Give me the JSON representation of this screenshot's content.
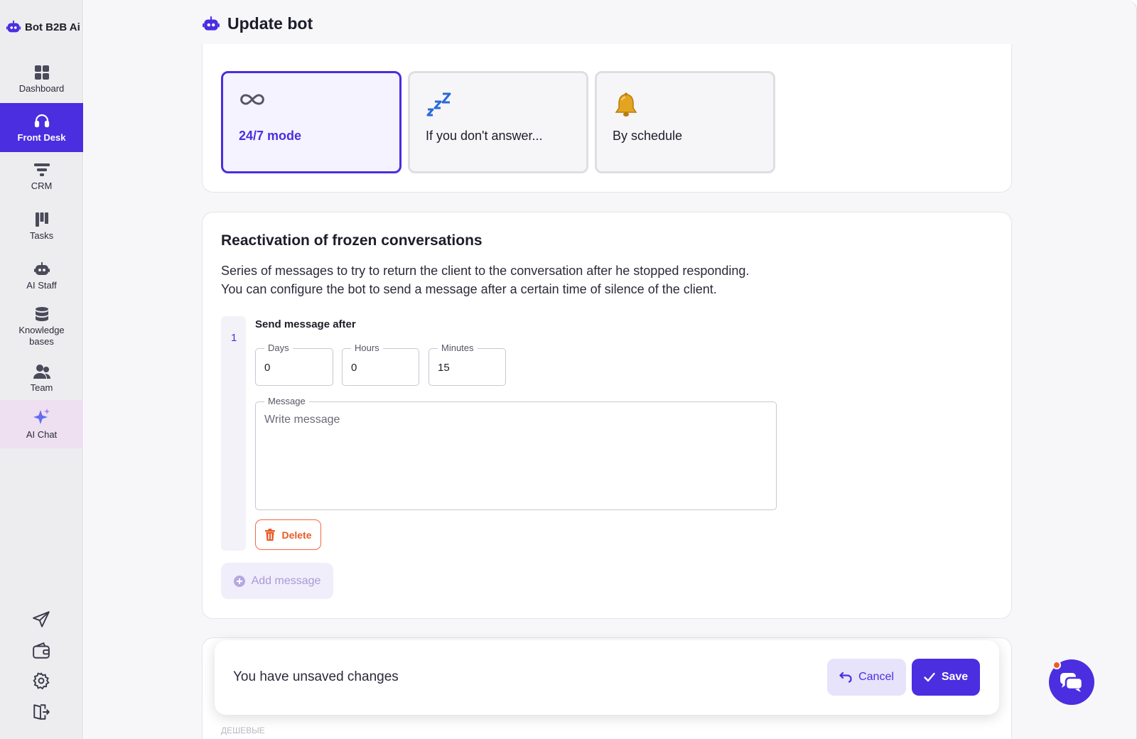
{
  "brand": {
    "name": "Bot B2B Ai"
  },
  "sidebar": {
    "items": [
      {
        "label": "Dashboard",
        "icon": "dashboard-grid-icon"
      },
      {
        "label": "Front Desk",
        "icon": "headset-icon",
        "active": true
      },
      {
        "label": "CRM",
        "icon": "funnel-icon"
      },
      {
        "label": "Tasks",
        "icon": "kanban-icon"
      },
      {
        "label": "AI Staff",
        "icon": "robot-icon"
      },
      {
        "label": "Knowledge bases",
        "icon": "database-icon"
      },
      {
        "label": "Team",
        "icon": "team-icon"
      },
      {
        "label": "AI Chat",
        "icon": "sparkle-icon"
      }
    ],
    "bottom_icons": [
      "send-icon",
      "wallet-icon",
      "settings-icon",
      "logout-icon"
    ]
  },
  "header": {
    "title": "Update bot",
    "icon": "robot-icon"
  },
  "modes": [
    {
      "label": "24/7 mode",
      "icon": "infinity-icon",
      "selected": true
    },
    {
      "label": "If you don't answer...",
      "icon": "zzz-icon",
      "selected": false
    },
    {
      "label": "By schedule",
      "icon": "bell-icon",
      "selected": false
    }
  ],
  "reactivation": {
    "title": "Reactivation of frozen conversations",
    "description_line1": "Series of messages to try to return the client to the conversation after he stopped responding.",
    "description_line2": "You can configure the bot to send a message after a certain time of silence of the client.",
    "step_number": "1",
    "send_after_label": "Send message after",
    "days": {
      "label": "Days",
      "value": "0"
    },
    "hours": {
      "label": "Hours",
      "value": "0"
    },
    "minutes": {
      "label": "Minutes",
      "value": "15"
    },
    "message": {
      "label": "Message",
      "placeholder": "Write message"
    },
    "delete_label": "Delete",
    "add_message_label": "Add message"
  },
  "unsaved": {
    "text": "You have unsaved changes",
    "cancel_label": "Cancel",
    "save_label": "Save"
  },
  "below_text": "ДЕШЕВЫЕ",
  "colors": {
    "accent": "#4a2ee0",
    "danger": "#e85a26",
    "sidebar_bg": "#ededf0",
    "notification_dot": "#f25b25"
  }
}
